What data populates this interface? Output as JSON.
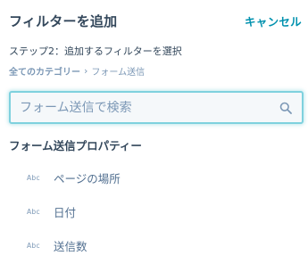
{
  "header": {
    "title": "フィルターを追加",
    "cancel_label": "キャンセル"
  },
  "step_text": "ステップ2：追加するフィルターを選択",
  "breadcrumb": {
    "root": "全てのカテゴリー",
    "separator": "›",
    "current": "フォーム送信"
  },
  "search": {
    "placeholder": "フォーム送信で検索",
    "value": "",
    "icon": "search-icon"
  },
  "section": {
    "title": "フォーム送信プロパティー"
  },
  "properties": [
    {
      "type_badge": "Abc",
      "label": "ページの場所"
    },
    {
      "type_badge": "Abc",
      "label": "日付"
    },
    {
      "type_badge": "Abc",
      "label": "送信数"
    }
  ],
  "colors": {
    "accent": "#0091ae",
    "text": "#33475b",
    "muted": "#7c98b6",
    "focus_border": "#7fd1de"
  }
}
